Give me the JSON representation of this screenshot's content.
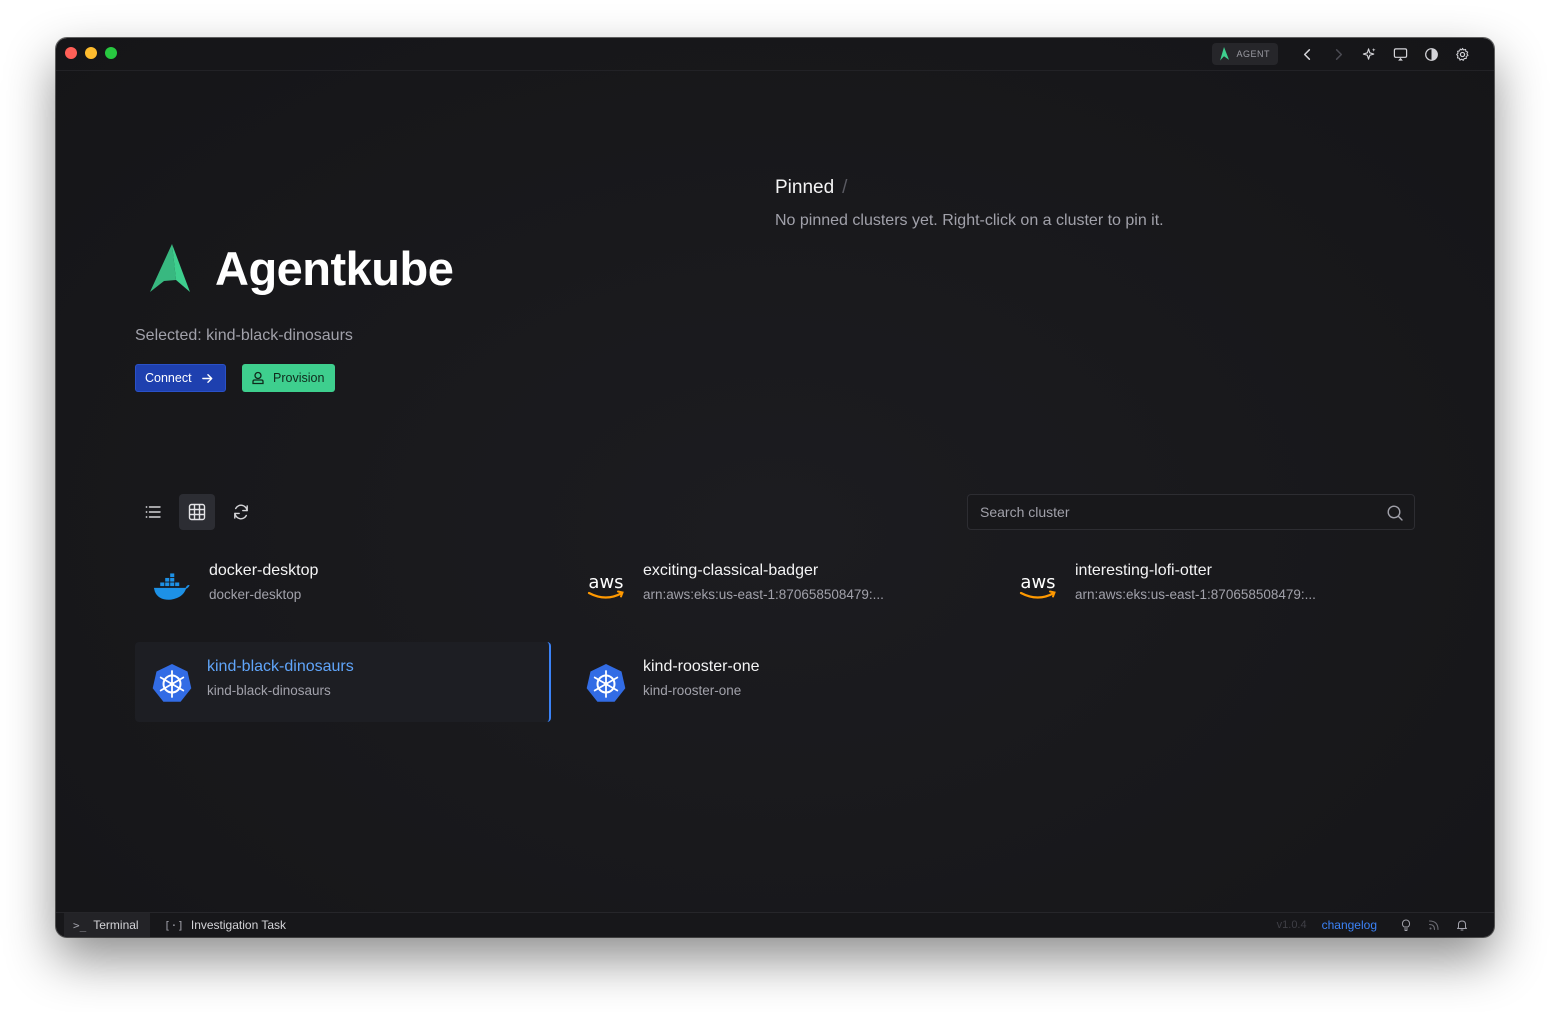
{
  "app": {
    "title": "Agentkube",
    "agent_badge": "AGENT"
  },
  "home": {
    "selected_label": "Selected: kind-black-dinosaurs",
    "connect_label": "Connect",
    "provision_label": "Provision"
  },
  "pinned": {
    "title": "Pinned",
    "separator": "/",
    "empty_message": "No pinned clusters yet. Right-click on a cluster to pin it."
  },
  "search": {
    "placeholder": "Search cluster",
    "value": ""
  },
  "clusters": [
    {
      "name": "docker-desktop",
      "context": "docker-desktop",
      "provider": "docker-icon",
      "selected": false
    },
    {
      "name": "exciting-classical-badger",
      "context": "arn:aws:eks:us-east-1:870658508479:...",
      "provider": "aws-icon",
      "selected": false
    },
    {
      "name": "interesting-lofi-otter",
      "context": "arn:aws:eks:us-east-1:870658508479:...",
      "provider": "aws-icon",
      "selected": false
    },
    {
      "name": "kind-black-dinosaurs",
      "context": "kind-black-dinosaurs",
      "provider": "kubernetes-icon",
      "selected": true
    },
    {
      "name": "kind-rooster-one",
      "context": "kind-rooster-one",
      "provider": "kubernetes-icon",
      "selected": false
    }
  ],
  "statusbar": {
    "terminal_label": "Terminal",
    "investigation_label": "Investigation Task",
    "version": "v1.0.4",
    "changelog_label": "changelog"
  },
  "colors": {
    "accent_blue": "#1e40af",
    "accent_green": "#3ecf8e",
    "selected_text": "#60a5fa",
    "background": "#18181b"
  }
}
